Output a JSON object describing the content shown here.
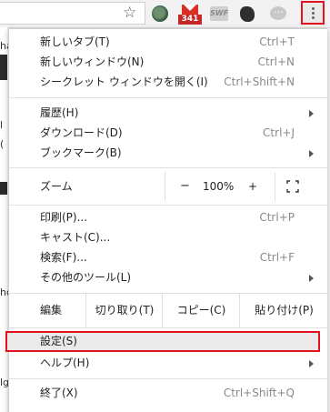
{
  "toolbar": {
    "bookmark_icon": "star-icon",
    "extensions": [
      {
        "name": "globe-extension-icon"
      },
      {
        "name": "gmail-checker-icon",
        "badge": "341"
      },
      {
        "name": "swf-extension-icon",
        "label": "SWF"
      },
      {
        "name": "evernote-icon"
      },
      {
        "name": "chat-extension-icon"
      }
    ],
    "menu_button_icon": "more-vert-icon",
    "menu_button_highlight_color": "#e3111b"
  },
  "background_page": {
    "chars": [
      "ha",
      "l",
      "(",
      "ho",
      "lg"
    ]
  },
  "menu": {
    "group1": [
      {
        "label": "新しいタブ(T)",
        "shortcut": "Ctrl+T"
      },
      {
        "label": "新しいウィンドウ(N)",
        "shortcut": "Ctrl+N"
      },
      {
        "label": "シークレット ウィンドウを開く(I)",
        "shortcut": "Ctrl+Shift+N"
      }
    ],
    "group2": [
      {
        "label": "履歴(H)",
        "shortcut": ""
      },
      {
        "label": "ダウンロード(D)",
        "shortcut": "Ctrl+J"
      },
      {
        "label": "ブックマーク(B)",
        "shortcut": ""
      }
    ],
    "zoom": {
      "label": "ズーム",
      "minus": "−",
      "value": "100%",
      "plus": "+",
      "fullscreen_icon": "fullscreen-icon"
    },
    "group3": [
      {
        "label": "印刷(P)...",
        "shortcut": "Ctrl+P"
      },
      {
        "label": "キャスト(C)...",
        "shortcut": ""
      },
      {
        "label": "検索(F)...",
        "shortcut": "Ctrl+F"
      },
      {
        "label": "その他のツール(L)",
        "shortcut": ""
      }
    ],
    "edit": {
      "label": "編集",
      "cut": "切り取り(T)",
      "copy": "コピー(C)",
      "paste": "貼り付け(P)"
    },
    "group4": [
      {
        "label": "設定(S)",
        "shortcut": ""
      },
      {
        "label": "ヘルプ(H)",
        "shortcut": ""
      }
    ],
    "exit": {
      "label": "終了(X)",
      "shortcut": "Ctrl+Shift+Q"
    }
  }
}
